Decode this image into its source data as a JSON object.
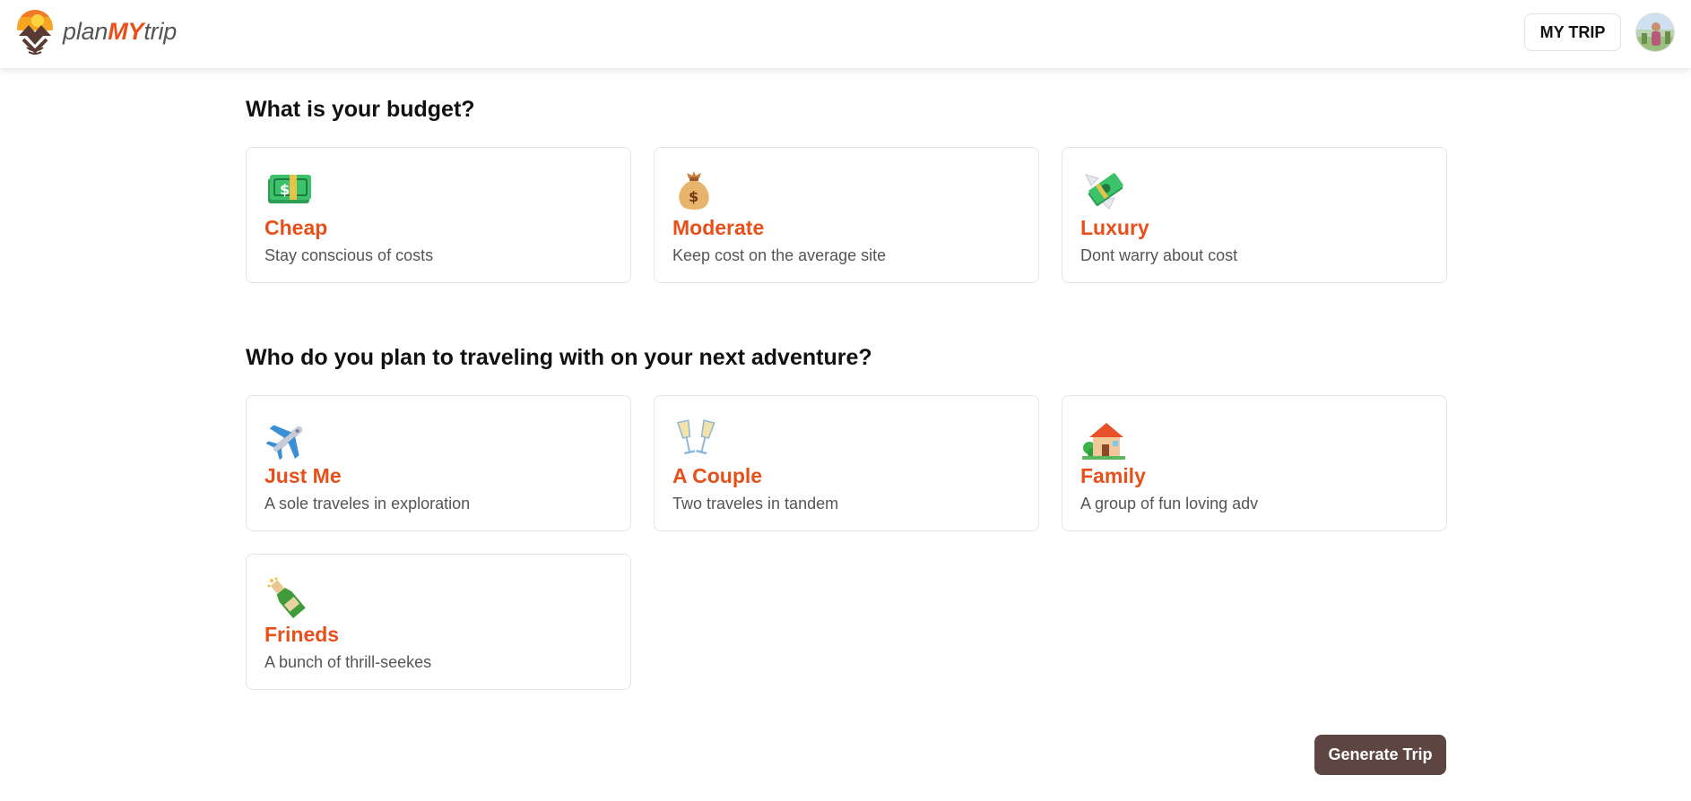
{
  "header": {
    "brand_prefix": "plan",
    "brand_mid": "MY",
    "brand_suffix": "trip",
    "my_trip_label": "MY TRIP",
    "logo_icon": "sunset-mountain-logo-icon",
    "avatar_icon": "user-avatar-icon"
  },
  "budget": {
    "heading": "What is your budget?",
    "options": [
      {
        "title": "Cheap",
        "desc": "Stay conscious of costs",
        "icon": "money-banknote-icon"
      },
      {
        "title": "Moderate",
        "desc": "Keep cost on the average site",
        "icon": "money-bag-icon"
      },
      {
        "title": "Luxury",
        "desc": "Dont warry about cost",
        "icon": "money-with-wings-icon"
      }
    ]
  },
  "travelers": {
    "heading": "Who do you plan to traveling with on your next adventure?",
    "options": [
      {
        "title": "Just Me",
        "desc": "A sole traveles in exploration",
        "icon": "airplane-icon"
      },
      {
        "title": "A Couple",
        "desc": "Two traveles in tandem",
        "icon": "clinking-glasses-icon"
      },
      {
        "title": "Family",
        "desc": "A group of fun loving adv",
        "icon": "house-with-garden-icon"
      },
      {
        "title": "Frineds",
        "desc": "A bunch of thrill-seekes",
        "icon": "champagne-bottle-icon"
      }
    ]
  },
  "actions": {
    "generate_label": "Generate Trip"
  },
  "colors": {
    "accent": "#e8501a",
    "button_dark": "#5d4541",
    "border": "#e5e5e5"
  }
}
